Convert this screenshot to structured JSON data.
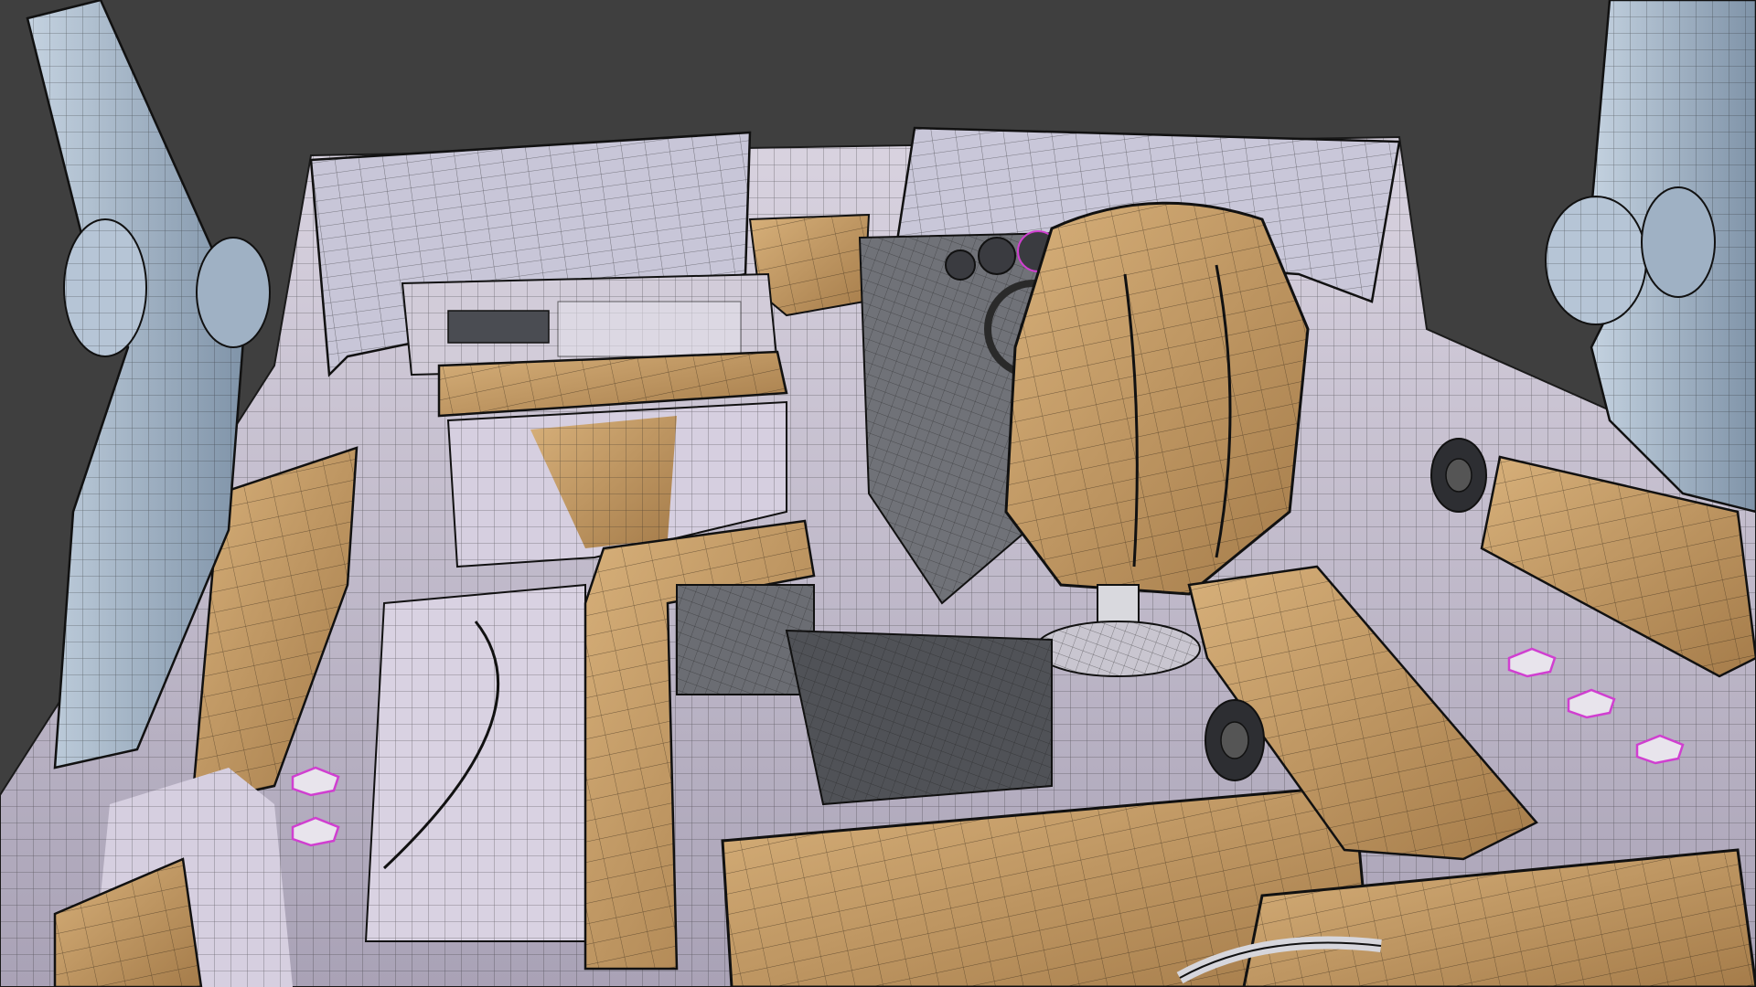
{
  "viewport": {
    "shading": "wireframe-over-solid",
    "colors": {
      "background": "#3f3f3f",
      "hull": "#cfc8d6",
      "hull_shade": "#a8a2b3",
      "upholstery": "#c9a06a",
      "upholstery_shade": "#9e7a4c",
      "tower": "#a9bccf",
      "tower_shade": "#7f93a8",
      "dark_panel": "#5e6066",
      "wire": "#1a1a1a",
      "accent_selected": "#d03fd0"
    }
  }
}
